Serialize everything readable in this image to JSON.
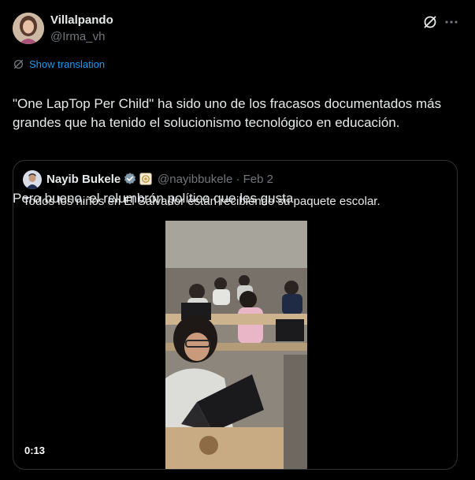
{
  "tweet": {
    "author": {
      "name": "Villalpando",
      "handle": "@Irma_vh",
      "avatar_icon": "profile-photo"
    },
    "show_translation": "Show translation",
    "paragraphs": [
      "\"One LapTop Per Child\" ha sido uno de los fracasos documentados más grandes que ha tenido el solucionismo tecnológico en educación.",
      "Pero bueno, el relumbrón político que les gusta."
    ]
  },
  "quote": {
    "author": {
      "name": "Nayib Bukele",
      "handle": "@nayibbukele",
      "separator": "·",
      "date": "Feb 2"
    },
    "text": "Todos los niños en El Salvador están recibiendo su paquete escolar.",
    "video": {
      "duration": "0:13"
    }
  },
  "colors": {
    "background": "#000000",
    "text": "#e7e9ea",
    "muted": "#71767b",
    "accent": "#1d9bf0",
    "border": "#2f3336"
  },
  "icons": [
    "grok-icon",
    "more-icon",
    "translate-icon",
    "verified-badge-icon",
    "affiliate-badge-icon"
  ]
}
